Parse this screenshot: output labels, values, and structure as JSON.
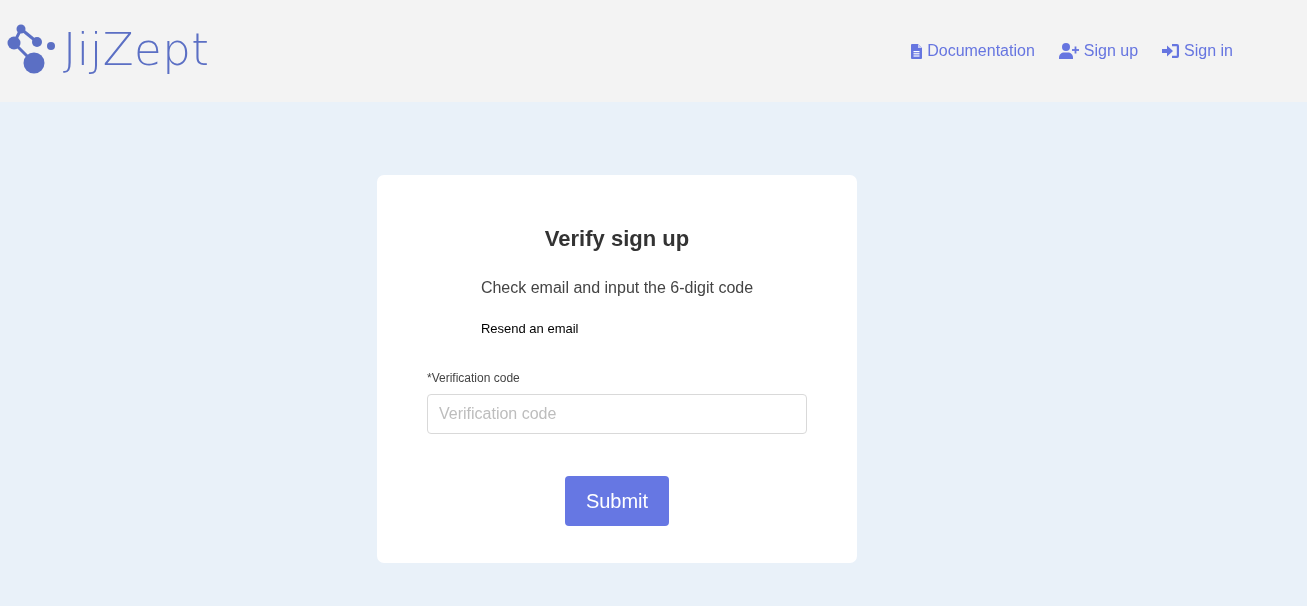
{
  "header": {
    "brand": "JijZept",
    "nav": [
      {
        "label": "Documentation"
      },
      {
        "label": "Sign up"
      },
      {
        "label": "Sign in"
      }
    ]
  },
  "card": {
    "title": "Verify sign up",
    "description": "Check email and input the 6-digit code",
    "resend_link": "Resend an email",
    "field": {
      "label": "*Verification code",
      "placeholder": "Verification code"
    },
    "submit": "Submit"
  }
}
